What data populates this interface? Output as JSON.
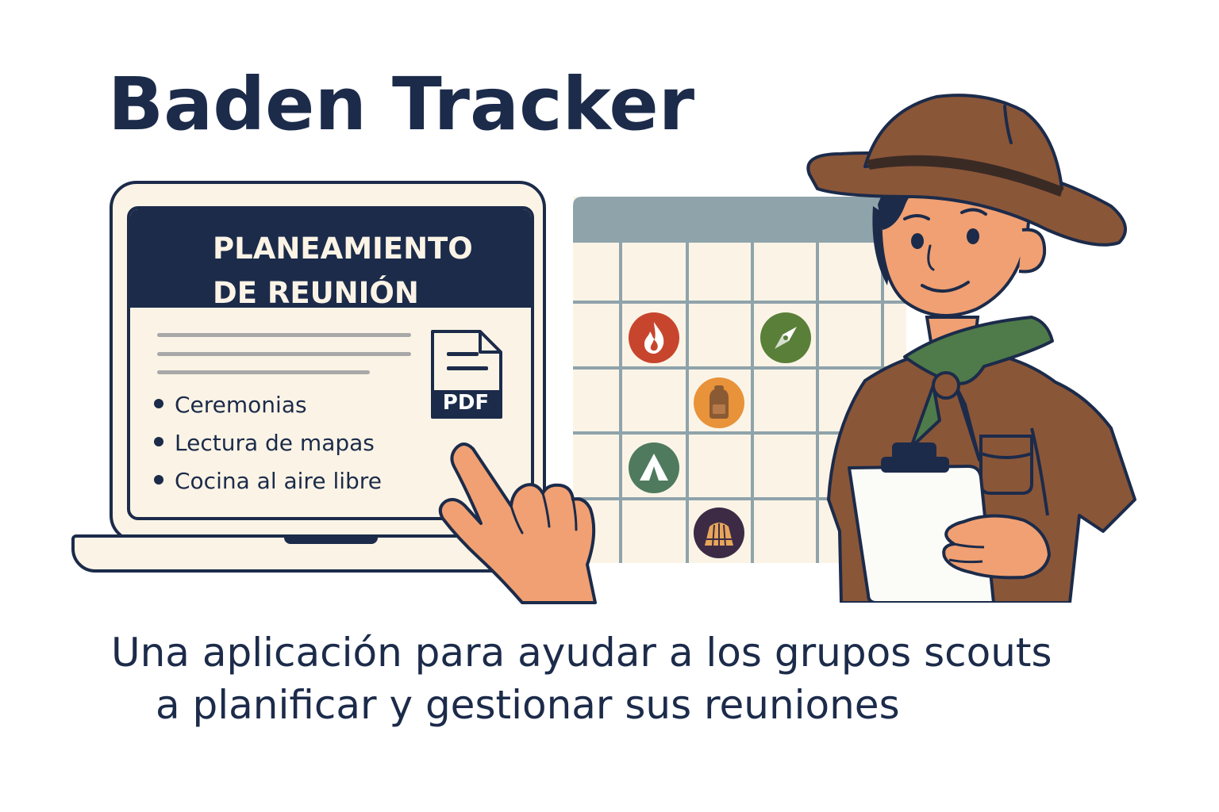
{
  "app": {
    "title": "Baden Tracker"
  },
  "laptop_screen": {
    "header_line1": "PLANEAMIENTO",
    "header_line2": "DE REUNIÓN",
    "items": [
      "Ceremonias",
      "Lectura de mapas",
      "Cocina al aire libre"
    ],
    "pdf_label": "PDF"
  },
  "calendar": {
    "icons": [
      "fire-icon",
      "compass-icon",
      "backpack-icon",
      "tent-icon",
      "shelter-icon"
    ]
  },
  "tagline": {
    "line1": "Una aplicación para ayudar a los grupos scouts",
    "line2": "a planificar y gestionar sus reuniones"
  },
  "colors": {
    "navy": "#1c2b4a",
    "cream": "#fbf4e6",
    "hat_brown": "#8a5638",
    "fire_red": "#c8452d",
    "compass_green": "#5a7f38",
    "backpack_orange": "#e8923a",
    "tent_green": "#4f7a5e",
    "shelter_purple": "#3d2b45"
  }
}
